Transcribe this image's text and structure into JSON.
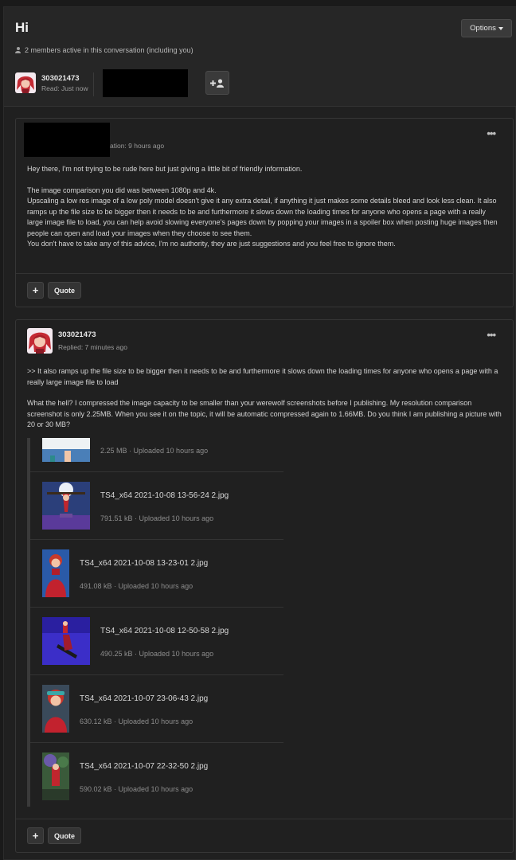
{
  "conversation": {
    "title": "Hi",
    "options_label": "Options",
    "members_text": "2 members active in this conversation (including you)",
    "participant": {
      "name": "303021473",
      "read_status": "Read: Just now"
    }
  },
  "messages": [
    {
      "time_fragment": "ation: 9 hours ago",
      "paragraphs": [
        "Hey there, I'm not trying to be rude here but just giving a little bit of friendly information.",
        "The image comparison you did was between 1080p and 4k.",
        "Upscaling a low res image of a low poly model doesn't give it any extra detail, if anything it just makes some details bleed and look less clean. It also ramps up the file size to be bigger then it needs to be and furthermore it slows down the loading times for anyone who opens a page with a really large image file to load, you can help avoid slowing everyone's pages down by popping your images in a spoiler box when posting huge images then people can open and load your images when they choose to see them.",
        "You don't have to take any of this advice, I'm no authority, they are just suggestions and you feel free to ignore them."
      ],
      "plus_label": "+",
      "quote_label": "Quote",
      "menu_label": "•••"
    },
    {
      "author": "303021473",
      "time": "Replied: 7 minutes ago",
      "quote_text": ">> It also ramps up the file size to be bigger then it needs to be and furthermore it slows down the loading times for anyone who opens a page with a really large image file to load",
      "reply_text": "What the hell? I compressed the image capacity to be smaller than your werewolf screenshots before I publishing. My resolution comparison screenshot is only 2.25MB. When you see it on the topic, it will be automatic compressed again to 1.66MB. Do you think I am publishing a picture with 20 or 30 MB?",
      "plus_label": "+",
      "quote_label": "Quote",
      "menu_label": "•••",
      "attachments": [
        {
          "name": "",
          "meta": "2.25 MB · Uploaded 10 hours ago"
        },
        {
          "name": "TS4_x64 2021-10-08 13-56-24 2.jpg",
          "meta": "791.51 kB · Uploaded 10 hours ago"
        },
        {
          "name": "TS4_x64 2021-10-08 13-23-01 2.jpg",
          "meta": "491.08 kB · Uploaded 10 hours ago"
        },
        {
          "name": "TS4_x64 2021-10-08 12-50-58 2.jpg",
          "meta": "490.25 kB · Uploaded 10 hours ago"
        },
        {
          "name": "TS4_x64 2021-10-07 23-06-43 2.jpg",
          "meta": "630.12 kB · Uploaded 10 hours ago"
        },
        {
          "name": "TS4_x64 2021-10-07 22-32-50 2.jpg",
          "meta": "590.02 kB · Uploaded 10 hours ago"
        }
      ]
    }
  ],
  "colors": {
    "page_bg": "#1a1a1a",
    "panel_bg": "#202020",
    "header_bg": "#262626",
    "button_bg": "#343434",
    "text": "#d6d6d6",
    "muted": "#9a9a9a"
  }
}
